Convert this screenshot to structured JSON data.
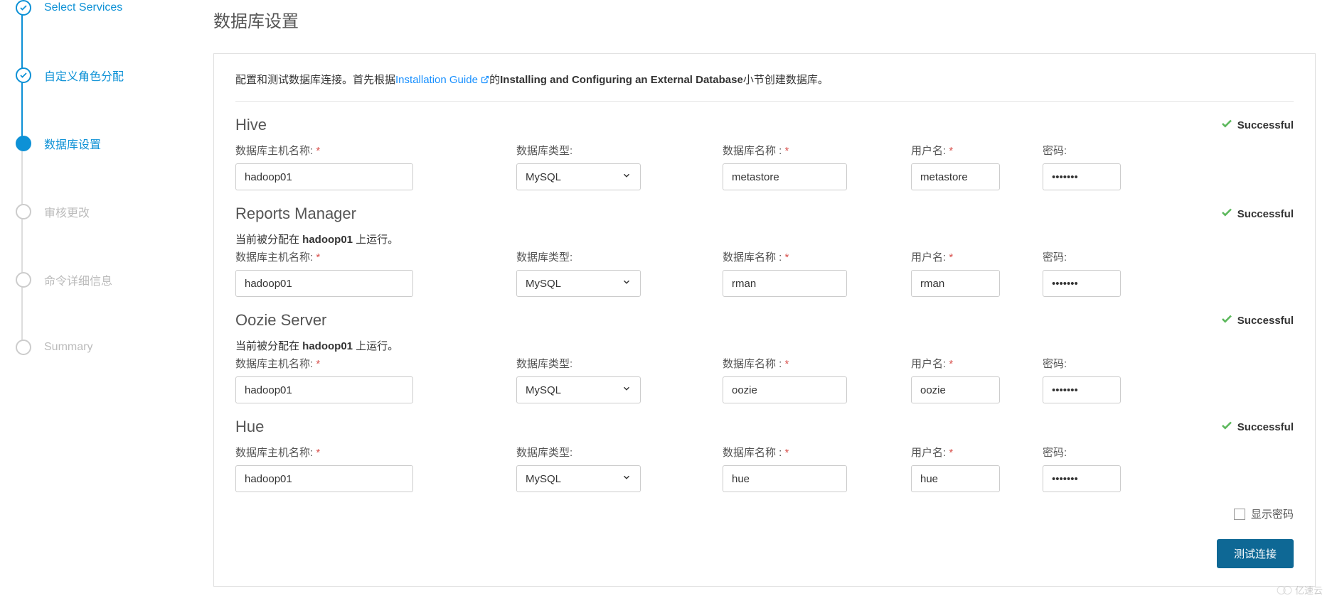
{
  "sidebar": {
    "steps": [
      {
        "label": "Select Services",
        "state": "done"
      },
      {
        "label": "自定义角色分配",
        "state": "done"
      },
      {
        "label": "数据库设置",
        "state": "active"
      },
      {
        "label": "审核更改",
        "state": "pending"
      },
      {
        "label": "命令详细信息",
        "state": "pending"
      },
      {
        "label": "Summary",
        "state": "pending"
      }
    ]
  },
  "page_title": "数据库设置",
  "instruction": {
    "prefix": "配置和测试数据库连接。首先根据",
    "link_text": "Installation Guide",
    "mid": "的",
    "bold": "Installing and Configuring an External Database",
    "suffix": "小节创建数据库。"
  },
  "labels": {
    "host": "数据库主机名称:",
    "dbtype": "数据库类型:",
    "dbname": "数据库名称 :",
    "user": "用户名:",
    "password": "密码:",
    "required": "*",
    "successful": "Successful",
    "show_password": "显示密码",
    "test_connection": "测试连接",
    "assigned_prefix": "当前被分配在 ",
    "assigned_suffix": " 上运行。"
  },
  "sections": [
    {
      "title": "Hive",
      "assigned_host": null,
      "host": "hadoop01",
      "dbtype": "MySQL",
      "dbname": "metastore",
      "user": "metastore",
      "password": "•••••••"
    },
    {
      "title": "Reports Manager",
      "assigned_host": "hadoop01",
      "host": "hadoop01",
      "dbtype": "MySQL",
      "dbname": "rman",
      "user": "rman",
      "password": "•••••••"
    },
    {
      "title": "Oozie Server",
      "assigned_host": "hadoop01",
      "host": "hadoop01",
      "dbtype": "MySQL",
      "dbname": "oozie",
      "user": "oozie",
      "password": "•••••••"
    },
    {
      "title": "Hue",
      "assigned_host": null,
      "host": "hadoop01",
      "dbtype": "MySQL",
      "dbname": "hue",
      "user": "hue",
      "password": "•••••••"
    }
  ],
  "watermark": "亿速云"
}
